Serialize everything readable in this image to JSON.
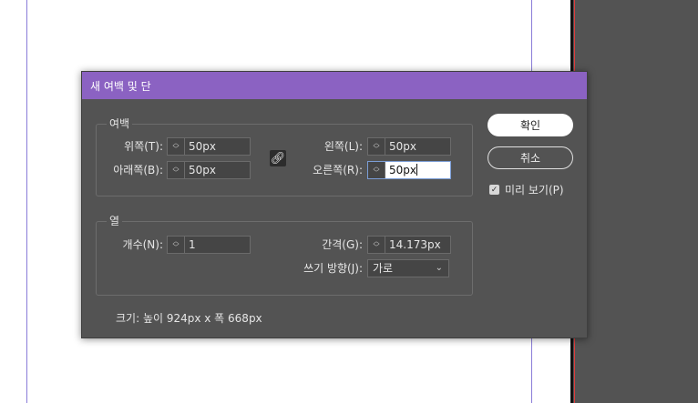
{
  "dialog": {
    "title": "새 여백 및 단",
    "margins": {
      "group_label": "여백",
      "top_label": "위쪽(T):",
      "top_value": "50px",
      "bottom_label": "아래쪽(B):",
      "bottom_value": "50px",
      "left_label": "왼쪽(L):",
      "left_value": "50px",
      "right_label": "오른쪽(R):",
      "right_value": "50px",
      "link_icon": "chain-link-icon"
    },
    "columns": {
      "group_label": "열",
      "count_label": "개수(N):",
      "count_value": "1",
      "gutter_label": "간격(G):",
      "gutter_value": "14.173px",
      "direction_label": "쓰기 방향(J):",
      "direction_value": "가로"
    },
    "size_text": "크기:  높이 924px x 폭 668px",
    "ok_label": "확인",
    "cancel_label": "취소",
    "preview_label": "미리 보기(P)",
    "preview_checked": true,
    "colors": {
      "titlebar": "#8b62c2",
      "dialog_bg": "#535353",
      "input_bg": "#454545"
    }
  }
}
